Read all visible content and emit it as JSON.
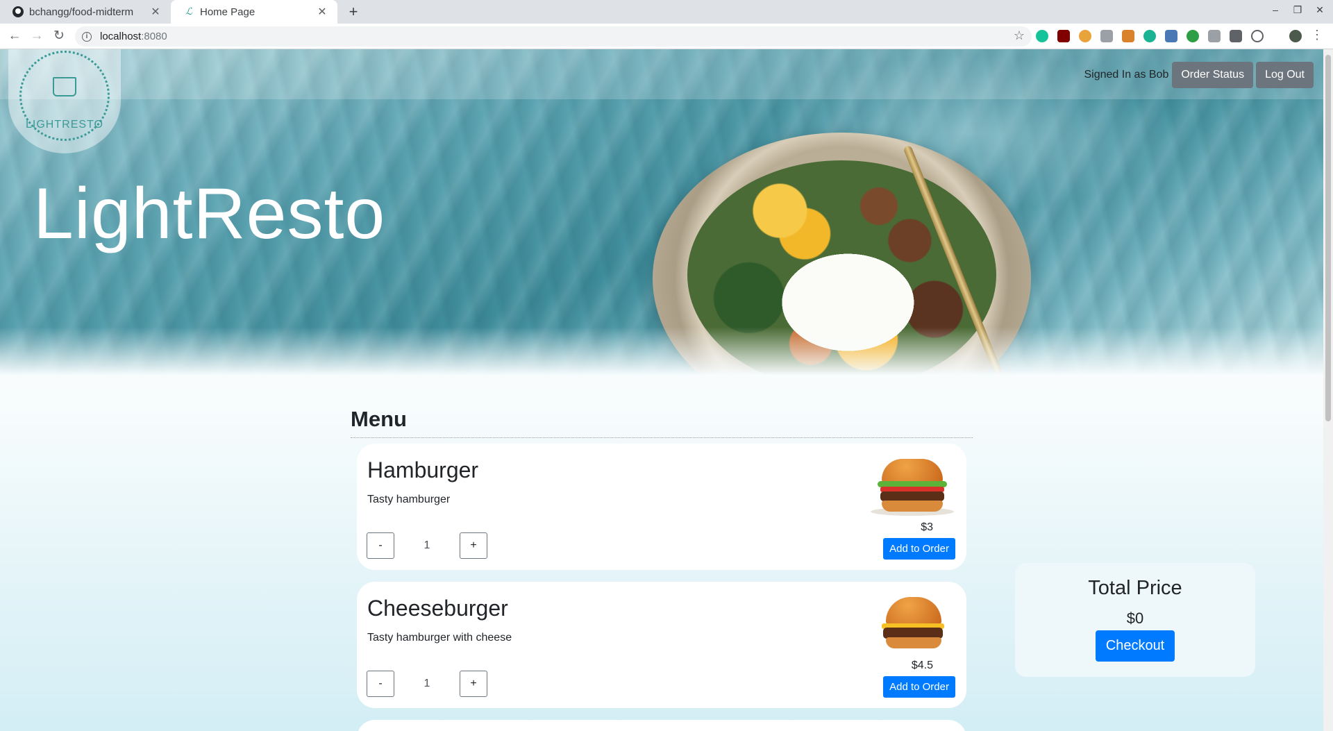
{
  "browser": {
    "tabs": [
      {
        "title": "bchangg/food-midterm",
        "active": false
      },
      {
        "title": "Home Page",
        "active": true
      }
    ],
    "new_tab_label": "+",
    "close_glyph": "✕",
    "url_host": "localhost",
    "url_port": ":8080",
    "window_controls": {
      "minimize": "–",
      "restore": "❐",
      "close": "✕"
    }
  },
  "header": {
    "logo_text": "LIGHTRESTO",
    "site_title": "LightResto",
    "signed_in_text": "Signed In as Bob",
    "order_status_label": "Order Status",
    "logout_label": "Log Out"
  },
  "menu": {
    "heading": "Menu",
    "items": [
      {
        "name": "Hamburger",
        "description": "Tasty hamburger",
        "price": "$3",
        "quantity": "1",
        "minus_label": "-",
        "plus_label": "+",
        "add_label": "Add to Order",
        "image": "hamburger-image"
      },
      {
        "name": "Cheeseburger",
        "description": "Tasty hamburger with cheese",
        "price": "$4.5",
        "quantity": "1",
        "minus_label": "-",
        "plus_label": "+",
        "add_label": "Add to Order",
        "image": "cheeseburger-image"
      }
    ]
  },
  "order": {
    "total_title": "Total Price",
    "total_value": "$0",
    "checkout_label": "Checkout"
  },
  "colors": {
    "primary": "#007bff",
    "secondary": "#6c757d",
    "brand_teal": "#3a9a96"
  }
}
